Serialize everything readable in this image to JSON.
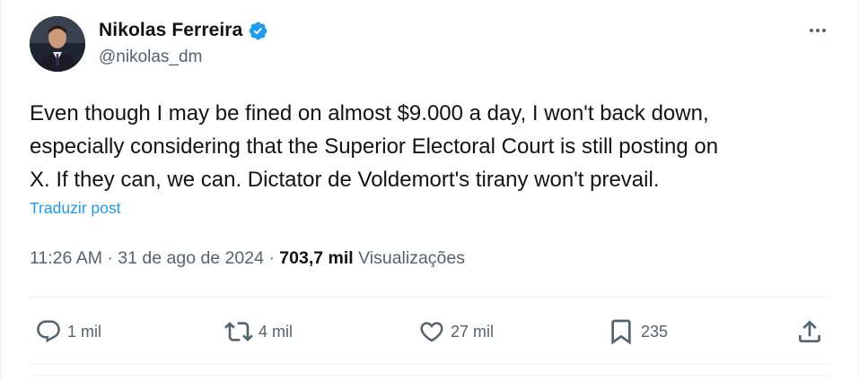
{
  "author": {
    "display_name": "Nikolas Ferreira",
    "handle": "@nikolas_dm",
    "verified": true
  },
  "post": {
    "text": "Even though I may be fined on almost $9.000 a day, I won't back down,\nespecially considering that the Superior Electoral Court is still posting on\nX. If they can, we can. Dictator de Voldemort's tirany won't prevail.",
    "translate_label": "Traduzir post",
    "time": "11:26 AM",
    "date": "31 de ago de 2024",
    "views_count": "703,7 mil",
    "views_label": "Visualizações"
  },
  "actions": {
    "replies": "1 mil",
    "reposts": "4 mil",
    "likes": "27 mil",
    "bookmarks": "235"
  },
  "colors": {
    "accent": "#1d9bf0",
    "secondary_text": "#536471",
    "primary_text": "#0f1419",
    "divider": "#eff3f4"
  },
  "icons": [
    "verified-badge-icon",
    "more-icon",
    "reply-icon",
    "repost-icon",
    "like-icon",
    "bookmark-icon",
    "share-icon"
  ]
}
